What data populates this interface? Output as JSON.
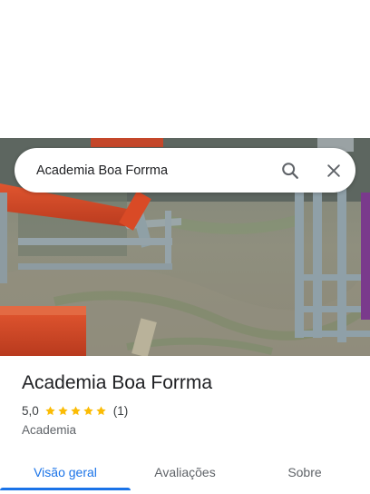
{
  "search": {
    "value": "Academia Boa Forrma",
    "search_icon": "search-icon",
    "clear_icon": "close-icon"
  },
  "place": {
    "name": "Academia Boa Forrma",
    "rating": "5,0",
    "stars": 5,
    "review_count": "(1)",
    "category": "Academia"
  },
  "tabs": [
    {
      "label": "Visão geral",
      "active": true
    },
    {
      "label": "Avaliações",
      "active": false
    },
    {
      "label": "Sobre",
      "active": false
    }
  ],
  "colors": {
    "accent": "#1a73e8",
    "star": "#fbbc04",
    "text_primary": "#202124",
    "text_secondary": "#5f6368"
  }
}
